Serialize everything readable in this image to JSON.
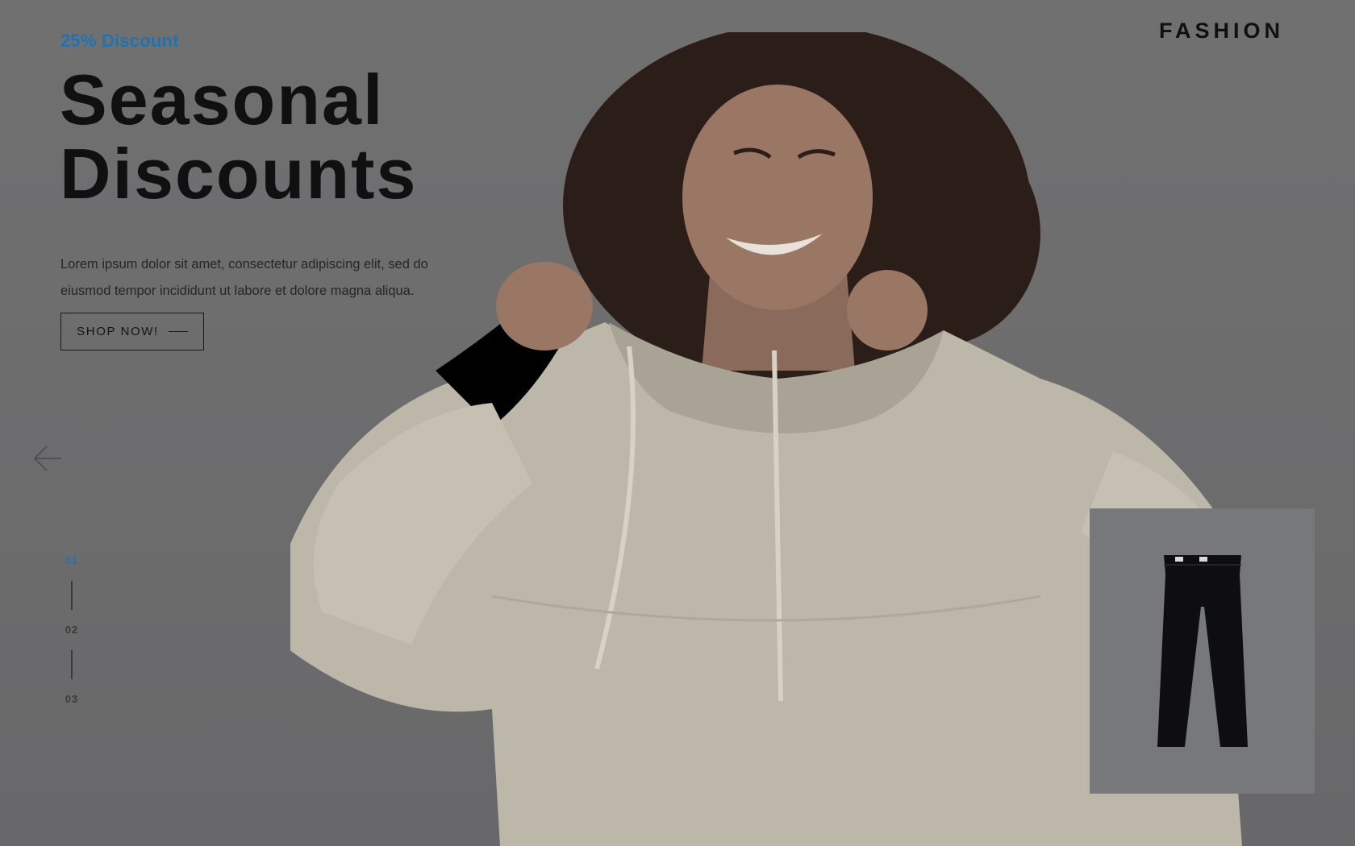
{
  "hero": {
    "eyebrow": "25% Discount",
    "headline_line1": "Seasonal",
    "headline_line2": "Discounts",
    "lead": "Lorem ipsum dolor sit amet, consectetur adipiscing elit, sed do eiusmod tempor incididunt ut labore et dolore magna aliqua.",
    "cta_label": "SHOP NOW!",
    "image_icon": "model-in-hoodie-photo"
  },
  "brand": {
    "logo_text": "FASHION"
  },
  "slider": {
    "prev_icon": "arrow-left-icon",
    "pages": [
      "01",
      "02",
      "03"
    ],
    "active_page": "01"
  },
  "product_thumb": {
    "icon": "jeans-icon"
  },
  "colors": {
    "accent": "#1e73b4",
    "overlay": "#6f6f70",
    "text": "#101010",
    "hoodie": "#c7c1b4"
  }
}
